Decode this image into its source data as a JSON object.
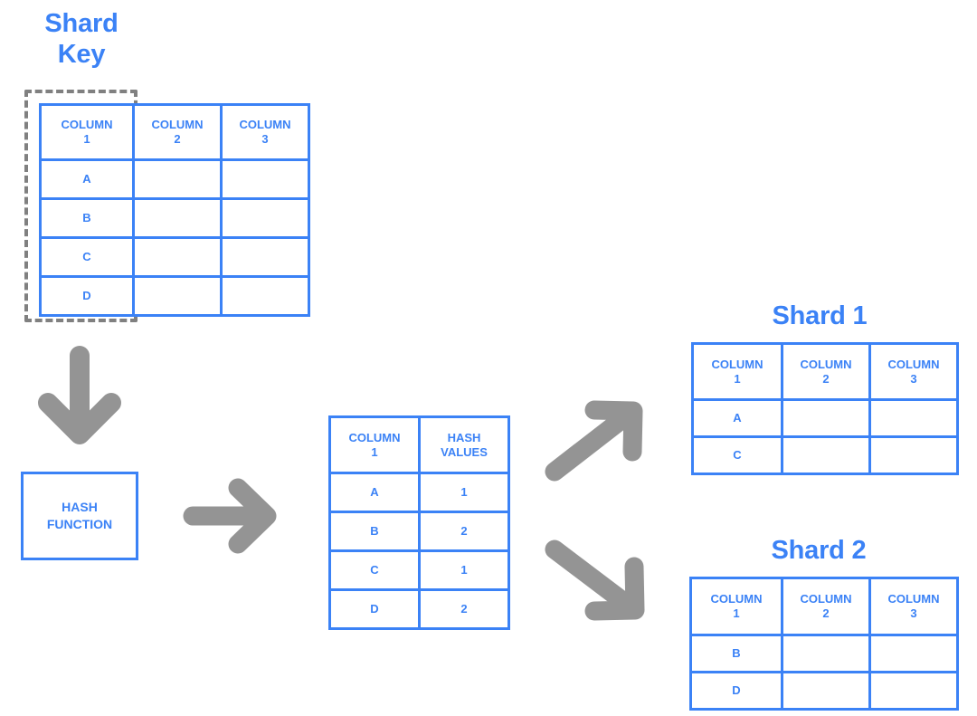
{
  "diagram": {
    "title_shard_key": "Shard\nKey",
    "title_shard_1": "Shard 1",
    "title_shard_2": "Shard 2",
    "hash_function_label": "HASH\nFUNCTION",
    "colors": {
      "blue": "#3b82f6",
      "gray": "#949494",
      "dashed_gray": "#808080",
      "background": "#ffffff"
    },
    "source_table": {
      "headers": [
        "COLUMN\n1",
        "COLUMN\n2",
        "COLUMN\n3"
      ],
      "rows": [
        [
          "A",
          "",
          ""
        ],
        [
          "B",
          "",
          ""
        ],
        [
          "C",
          "",
          ""
        ],
        [
          "D",
          "",
          ""
        ]
      ]
    },
    "hash_table": {
      "headers": [
        "COLUMN\n1",
        "HASH\nVALUES"
      ],
      "rows": [
        [
          "A",
          "1"
        ],
        [
          "B",
          "2"
        ],
        [
          "C",
          "1"
        ],
        [
          "D",
          "2"
        ]
      ]
    },
    "shard1_table": {
      "headers": [
        "COLUMN\n1",
        "COLUMN\n2",
        "COLUMN\n3"
      ],
      "rows": [
        [
          "A",
          "",
          ""
        ],
        [
          "C",
          "",
          ""
        ]
      ]
    },
    "shard2_table": {
      "headers": [
        "COLUMN\n1",
        "COLUMN\n2",
        "COLUMN\n3"
      ],
      "rows": [
        [
          "B",
          "",
          ""
        ],
        [
          "D",
          "",
          ""
        ]
      ]
    },
    "arrows": [
      {
        "name": "arrow-down-to-hash-function",
        "direction": "down"
      },
      {
        "name": "arrow-right-to-hash-table",
        "direction": "right"
      },
      {
        "name": "arrow-up-right-to-shard-1",
        "direction": "up-right"
      },
      {
        "name": "arrow-down-right-to-shard-2",
        "direction": "down-right"
      }
    ]
  }
}
